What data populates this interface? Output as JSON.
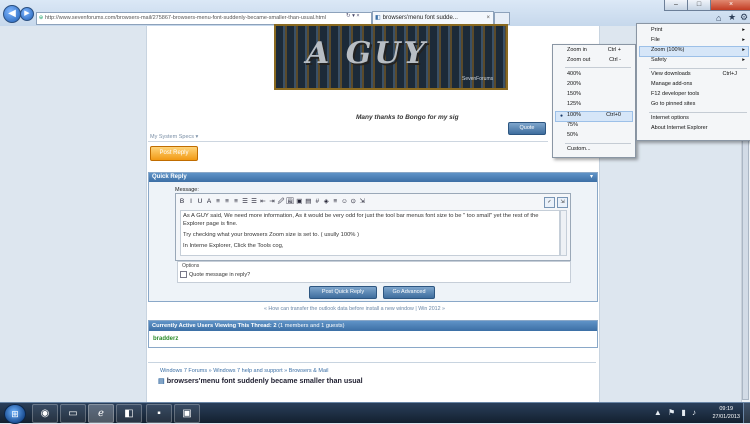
{
  "browser": {
    "address": "http://www.sevenforums.com/browsers-mail/275867-browsers-menu-font-suddenly-became-smaller-than-usual.html",
    "tab_title": "browsers'menu font sudde...",
    "tab_close": "×",
    "address_icons": "↻ ▾ ×",
    "window_controls": {
      "minimize": "–",
      "maximize": "□",
      "close": "×"
    },
    "toolbar_icons": [
      "home-icon",
      "favorites-icon",
      "tools-icon"
    ]
  },
  "signature": {
    "title": "A GUY",
    "caption": "SevenForums",
    "thanks": "Many thanks to Bongo for my sig"
  },
  "post": {
    "system_specs": "My System Specs",
    "quote_button": "Quote",
    "post_reply_button": "Post Reply"
  },
  "quick_reply": {
    "header": "Quick Reply",
    "message_label": "Message:",
    "toolbar": [
      "B",
      "I",
      "U",
      "A",
      "≡",
      "≡",
      "≡",
      "☰",
      "☰",
      "⇤",
      "⇥",
      "🖉",
      "🖼",
      "▣",
      "▤",
      "#",
      "◈",
      "≡",
      "☺",
      "⊙",
      "⇲"
    ],
    "text_paragraphs": [
      "As A GUY said, We need more information, As it would be very odd for just the tool bar menus font size to be \" too small\" yet the rest of the Explorer page is fine.",
      "Try checking what your browsers Zoom size is set to. ( usully 100% )",
      "In Interne Explorer, Click the Tools cog,"
    ],
    "options_label": "Options",
    "quote_checkbox": "Quote message in reply?",
    "post_quick_reply": "Post Quick Reply",
    "go_advanced": "Go Advanced"
  },
  "prev_next": "« How can transfer the outlook data before install a new window | Win 2012 »",
  "active_users": {
    "header": "Currently Active Users Viewing This Thread: 2",
    "header_detail": "(1 members and 1 guests)",
    "users": [
      "bradderz"
    ]
  },
  "breadcrumb": {
    "path": [
      "Windows 7 Forums",
      "Windows 7 help and support",
      "Browsers & Mail"
    ],
    "separator": " » ",
    "thread_title": "browsers'menu font suddenly became smaller than usual"
  },
  "tools_menu": {
    "items": [
      {
        "label": "Print",
        "arrow": true
      },
      {
        "label": "File",
        "arrow": true
      },
      {
        "label": "Zoom (100%)",
        "arrow": true
      },
      {
        "label": "Safety",
        "arrow": true
      },
      {
        "label": "View downloads",
        "shortcut": "Ctrl+J"
      },
      {
        "label": "Manage add-ons"
      },
      {
        "label": "F12 developer tools"
      },
      {
        "label": "Go to pinned sites"
      },
      {
        "label": "Internet options"
      },
      {
        "label": "About Internet Explorer"
      }
    ]
  },
  "zoom_menu": {
    "items": [
      {
        "label": "Zoom in",
        "shortcut": "Ctrl +"
      },
      {
        "label": "Zoom out",
        "shortcut": "Ctrl -"
      },
      {
        "label": "400%"
      },
      {
        "label": "200%"
      },
      {
        "label": "150%"
      },
      {
        "label": "125%"
      },
      {
        "label": "100%",
        "shortcut": "Ctrl+0",
        "selected": true
      },
      {
        "label": "75%"
      },
      {
        "label": "50%"
      },
      {
        "label": "Custom..."
      }
    ]
  },
  "taskbar": {
    "apps": [
      "explorer-icon",
      "chrome-icon",
      "folder-icon",
      "ie-icon",
      "forum-app-icon",
      "cmd-icon",
      "display-icon"
    ],
    "tray_icons": "▲ ⚑ ▮ ♪",
    "time": "09:19",
    "date": "27/01/2013"
  },
  "colors": {
    "accent": "#3c6fa5",
    "post_reply": "#f29a14",
    "user_green": "#2a8a2a"
  }
}
